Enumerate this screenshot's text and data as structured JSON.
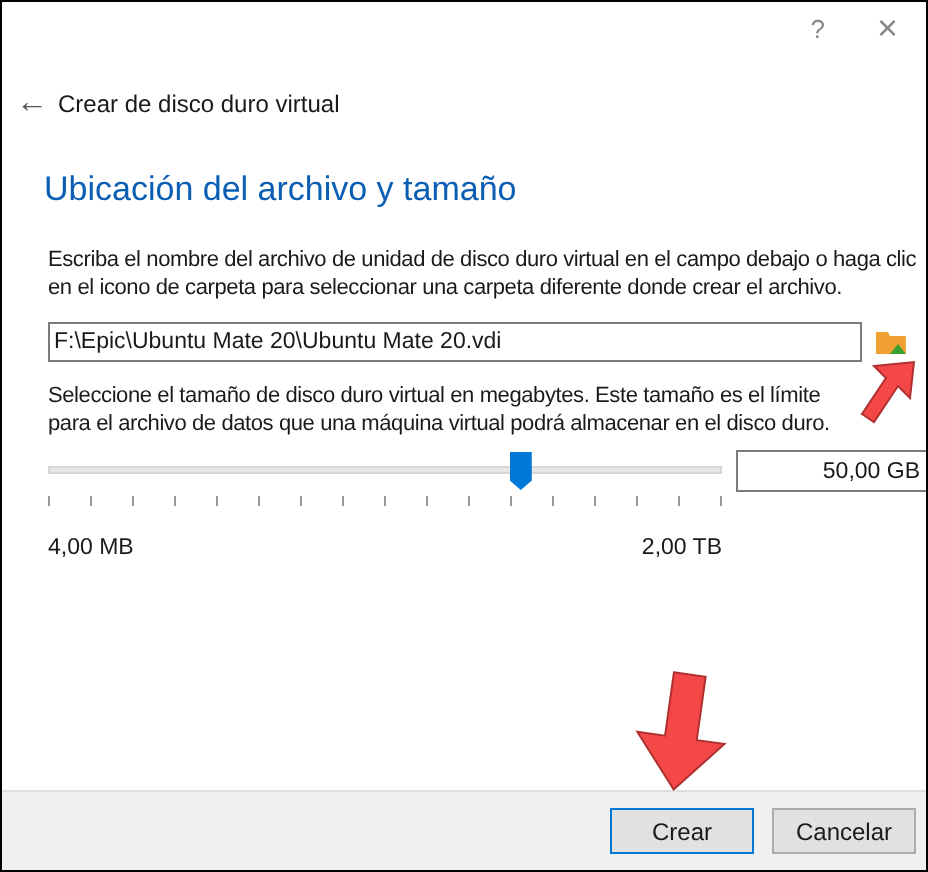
{
  "window": {
    "help": "?",
    "close": "×"
  },
  "header": {
    "back": "←",
    "title": "Crear de disco duro virtual"
  },
  "section_title": "Ubicación del archivo y tamaño",
  "location": {
    "description": "Escriba el nombre del archivo de unidad de disco duro virtual en el campo debajo o haga clic en el icono de carpeta para seleccionar una carpeta diferente donde crear el archivo.",
    "value": "F:\\Epic\\Ubuntu Mate 20\\Ubuntu Mate 20.vdi"
  },
  "size": {
    "description": "Seleccione el tamaño de disco duro virtual en megabytes. Este tamaño es el límite para el archivo de datos que una máquina virtual podrá almacenar en el disco duro.",
    "level": 0.7,
    "value": "50,00 GB",
    "min_label": "4,00 MB",
    "max_label": "2,00 TB"
  },
  "buttons": [
    {
      "label": "Crear",
      "kind": "default"
    },
    {
      "label": "Cancelar",
      "kind": "normal"
    }
  ]
}
